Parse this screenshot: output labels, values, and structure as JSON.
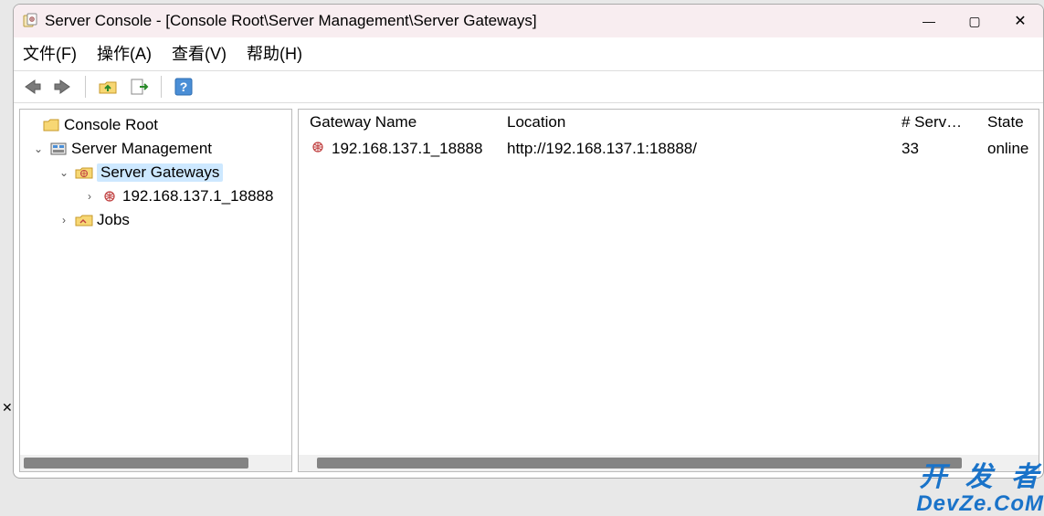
{
  "title": "Server Console - [Console Root\\Server Management\\Server Gateways]",
  "win_controls": {
    "min": "—",
    "max": "▢",
    "close": "✕"
  },
  "menu": {
    "file": "文件(F)",
    "action": "操作(A)",
    "view": "查看(V)",
    "help": "帮助(H)"
  },
  "toolbar_icons": {
    "back": "back-arrow-icon",
    "forward": "forward-arrow-icon",
    "folder_up": "folder-up-icon",
    "export": "export-icon",
    "help": "help-icon"
  },
  "tree": {
    "root": "Console Root",
    "management": "Server Management",
    "gateways": "Server Gateways",
    "gateway_node": "192.168.137.1_18888",
    "jobs": "Jobs"
  },
  "columns": {
    "name": "Gateway Name",
    "location": "Location",
    "servers": "# Serv…",
    "state": "State"
  },
  "rows": [
    {
      "name": "192.168.137.1_18888",
      "location": "http://192.168.137.1:18888/",
      "servers": "33",
      "state": "online"
    }
  ],
  "watermark": {
    "line1": "开 发 者",
    "line2": "DevZe.CoM"
  },
  "aux_close": "✕"
}
